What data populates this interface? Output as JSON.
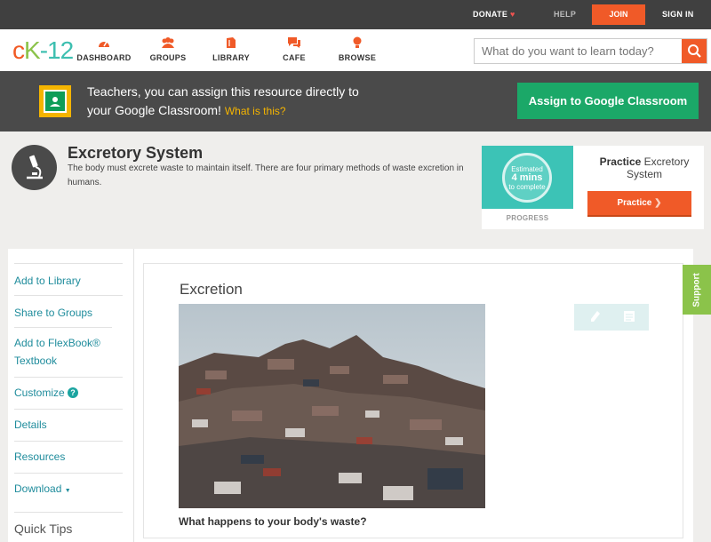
{
  "topbar": {
    "donate": "DONATE",
    "help": "HELP",
    "join": "JOIN",
    "signin": "SIGN IN"
  },
  "logo": {
    "c": "c",
    "k": "K",
    "n": "-12"
  },
  "nav": [
    {
      "label": "DASHBOARD",
      "icon": "dashboard-icon"
    },
    {
      "label": "GROUPS",
      "icon": "groups-icon"
    },
    {
      "label": "LIBRARY",
      "icon": "library-icon"
    },
    {
      "label": "CAFE",
      "icon": "cafe-icon"
    },
    {
      "label": "BROWSE",
      "icon": "browse-icon"
    }
  ],
  "search": {
    "placeholder": "What do you want to learn today?"
  },
  "google": {
    "line1": "Teachers, you can assign this resource directly to",
    "line2": "your Google Classroom!",
    "what": "What is this?",
    "button": "Assign to Google Classroom"
  },
  "concept": {
    "title": "Excretory System",
    "description": "The body must excrete waste to maintain itself. There are four primary methods of waste excretion in humans."
  },
  "practice": {
    "estimated": "Estimated",
    "mins": "4 mins",
    "complete": "to complete",
    "progress": "PROGRESS",
    "title_bold": "Practice",
    "title_rest": "Excretory System",
    "button": "Practice"
  },
  "sidebar": {
    "items": [
      {
        "label": "Add to Library"
      },
      {
        "label": "Share to Groups"
      },
      {
        "label": "Add to FlexBook® Textbook"
      },
      {
        "label": "Customize"
      },
      {
        "label": "Details"
      },
      {
        "label": "Resources"
      },
      {
        "label": "Download"
      }
    ],
    "customize_q": "?",
    "download_caret": "▼",
    "quick_tips": "Quick Tips"
  },
  "content": {
    "title": "Excretion",
    "caption": "What happens to your body's waste?"
  },
  "support": "Support",
  "colors": {
    "accent": "#f05a28",
    "green": "#1ba868",
    "teal": "#3cc3b6",
    "link": "#1f8c9c"
  }
}
